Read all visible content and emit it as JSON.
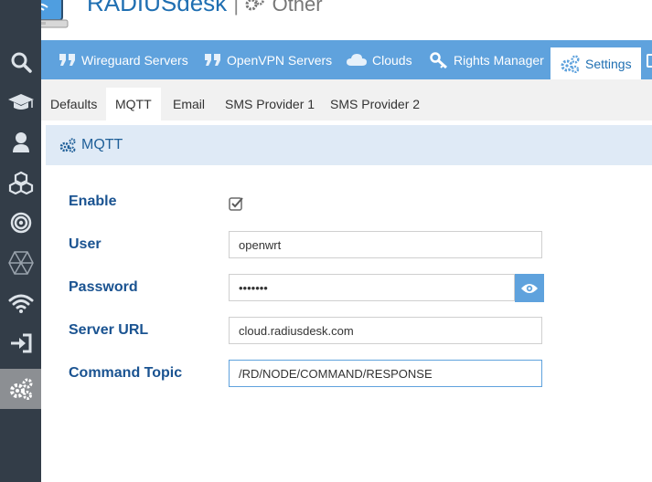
{
  "header": {
    "title": "RADIUSdesk",
    "separator": "|",
    "subtitle": "Other"
  },
  "sidebar": {
    "items": [
      {
        "icon": "search-icon",
        "active": false
      },
      {
        "icon": "graduation-cap-icon",
        "active": false
      },
      {
        "icon": "user-icon",
        "active": false
      },
      {
        "icon": "cubes-icon",
        "active": false
      },
      {
        "icon": "bullseye-icon",
        "active": false
      },
      {
        "icon": "hexagon-mesh-icon",
        "active": false
      },
      {
        "icon": "wifi-icon",
        "active": false
      },
      {
        "icon": "sign-in-icon",
        "active": false
      },
      {
        "icon": "gears-icon",
        "active": true
      }
    ]
  },
  "tabs": [
    {
      "label": "Wireguard Servers",
      "icon": "quote-icon"
    },
    {
      "label": "OpenVPN Servers",
      "icon": "quote-icon"
    },
    {
      "label": "Clouds",
      "icon": "cloud-icon"
    },
    {
      "label": "Rights Manager",
      "icon": "key-icon"
    },
    {
      "label": "Settings",
      "icon": "gears-icon",
      "active": true
    }
  ],
  "subtabs": [
    {
      "label": "Defaults"
    },
    {
      "label": "MQTT",
      "active": true
    },
    {
      "label": "Email"
    },
    {
      "label": "SMS Provider 1"
    },
    {
      "label": "SMS Provider 2"
    }
  ],
  "panel": {
    "title": "MQTT",
    "form": {
      "enable_label": "Enable",
      "enable_checked": true,
      "user_label": "User",
      "user_value": "openwrt",
      "password_label": "Password",
      "password_value": "•••••••",
      "server_url_label": "Server URL",
      "server_url_value": "cloud.radiusdesk.com",
      "command_topic_label": "Command Topic",
      "command_topic_value": "/RD/NODE/COMMAND/RESPONSE"
    }
  },
  "colors": {
    "sidebar": "#333d48",
    "tabbar": "#5fa2dd",
    "accent": "#1f6fb2",
    "label": "#1a5391"
  }
}
